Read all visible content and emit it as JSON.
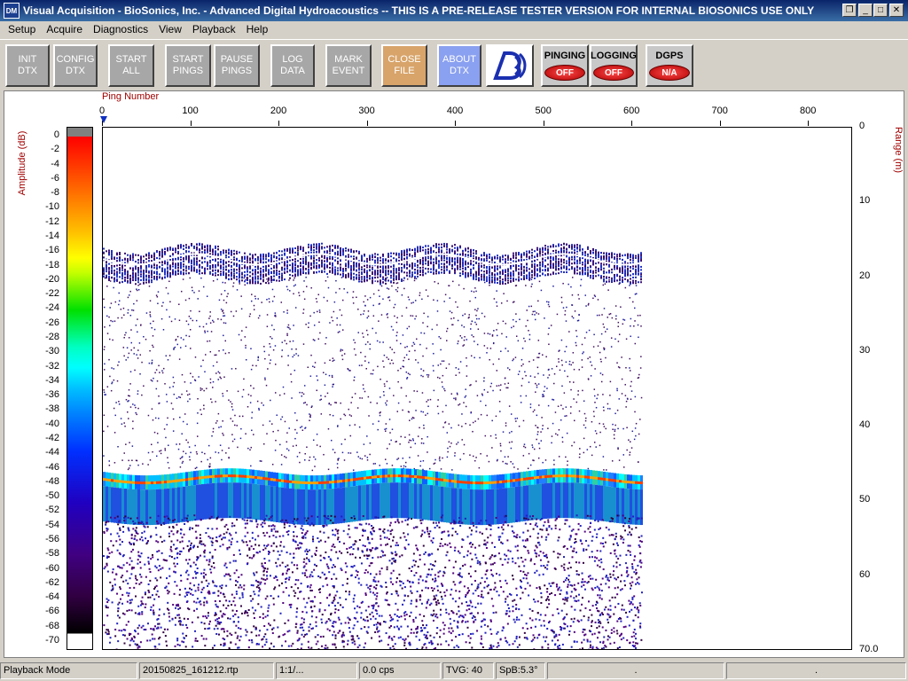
{
  "window": {
    "icon_text": "DM",
    "title": "Visual Acquisition  -  BioSonics, Inc.  -  Advanced Digital Hydroacoustics  -- THIS IS A PRE-RELEASE TESTER VERSION FOR INTERNAL BIOSONICS USE ONLY",
    "controls": [
      "restore-icon",
      "minimize-icon",
      "maximize-icon",
      "close-icon"
    ]
  },
  "menu": [
    "Setup",
    "Acquire",
    "Diagnostics",
    "View",
    "Playback",
    "Help"
  ],
  "toolbar": {
    "init": "INIT\nDTX",
    "config": "CONFIG\nDTX",
    "start_all": "START\nALL",
    "start_pings": "START\nPINGS",
    "pause_pings": "PAUSE\nPINGS",
    "log_data": "LOG\nDATA",
    "mark_event": "MARK\nEVENT",
    "close_file": "CLOSE\nFILE",
    "about": "ABOUT\nDTX",
    "pinging_label": "PINGING",
    "pinging_state": "OFF",
    "logging_label": "LOGGING",
    "logging_state": "OFF",
    "dgps_label": "DGPS",
    "dgps_state": "N/A"
  },
  "echogram": {
    "ping_axis_label": "Ping Number",
    "amplitude_label": "Amplitude (dB)",
    "range_label": "Range (m)",
    "ping_ticks": [
      "0",
      "100",
      "200",
      "300",
      "400",
      "500",
      "600",
      "700",
      "800"
    ],
    "range_ticks": [
      "0",
      "10",
      "20",
      "30",
      "40",
      "50",
      "60",
      "70.0"
    ],
    "amplitude_ticks": [
      "0",
      "-2",
      "-4",
      "-6",
      "-8",
      "-10",
      "-12",
      "-14",
      "-16",
      "-18",
      "-20",
      "-22",
      "-24",
      "-26",
      "-28",
      "-30",
      "-32",
      "-34",
      "-36",
      "-38",
      "-40",
      "-42",
      "-44",
      "-46",
      "-48",
      "-50",
      "-52",
      "-54",
      "-56",
      "-58",
      "-60",
      "-62",
      "-64",
      "-66",
      "-68",
      "-70"
    ],
    "ping_max": 850,
    "range_max": 70,
    "pings_recorded": 610,
    "fish_layer_depth_m": 17.5,
    "bottom_depth_m": 47
  },
  "status": {
    "mode": "Playback Mode",
    "file": "20150825_161212.rtp",
    "ratio": "1:1/...",
    "rate": "0.0 cps",
    "tvg": "TVG: 40",
    "spb": "SpB:5.3°",
    "f1": ".",
    "f2": "."
  }
}
